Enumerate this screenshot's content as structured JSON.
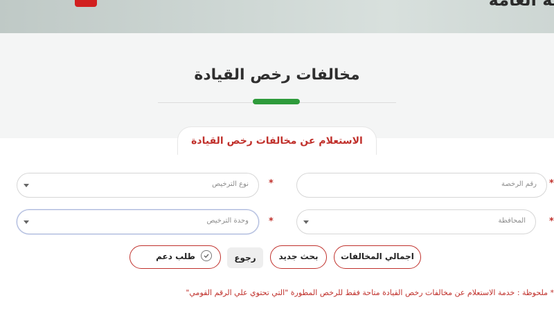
{
  "header": {
    "site_title": "ـة العامة"
  },
  "page": {
    "title": "مخالفات رخص القيادة",
    "card_tab": "الاستعلام عن مخالفات رخص القيادة"
  },
  "form": {
    "license_number": {
      "placeholder": "رقم الرخصة"
    },
    "license_type": {
      "placeholder": "نوع الترخيص"
    },
    "governorate": {
      "placeholder": "المحافظة"
    },
    "licensing_unit": {
      "placeholder": "وحدة الترخيص"
    }
  },
  "buttons": {
    "total_violations": "اجمالي المخالفات",
    "new_search": "بحث جديد",
    "back": "رجوع",
    "support_request": "طلب دعم"
  },
  "note": "* ملحوظة : خدمة الاستعلام عن مخالفات رخص القيادة متاحة فقط للرخص المطورة \"التي تحتوي علي الرقم القومي\"",
  "colors": {
    "accent_red": "#c0302b",
    "accent_green": "#2e9b3b"
  }
}
